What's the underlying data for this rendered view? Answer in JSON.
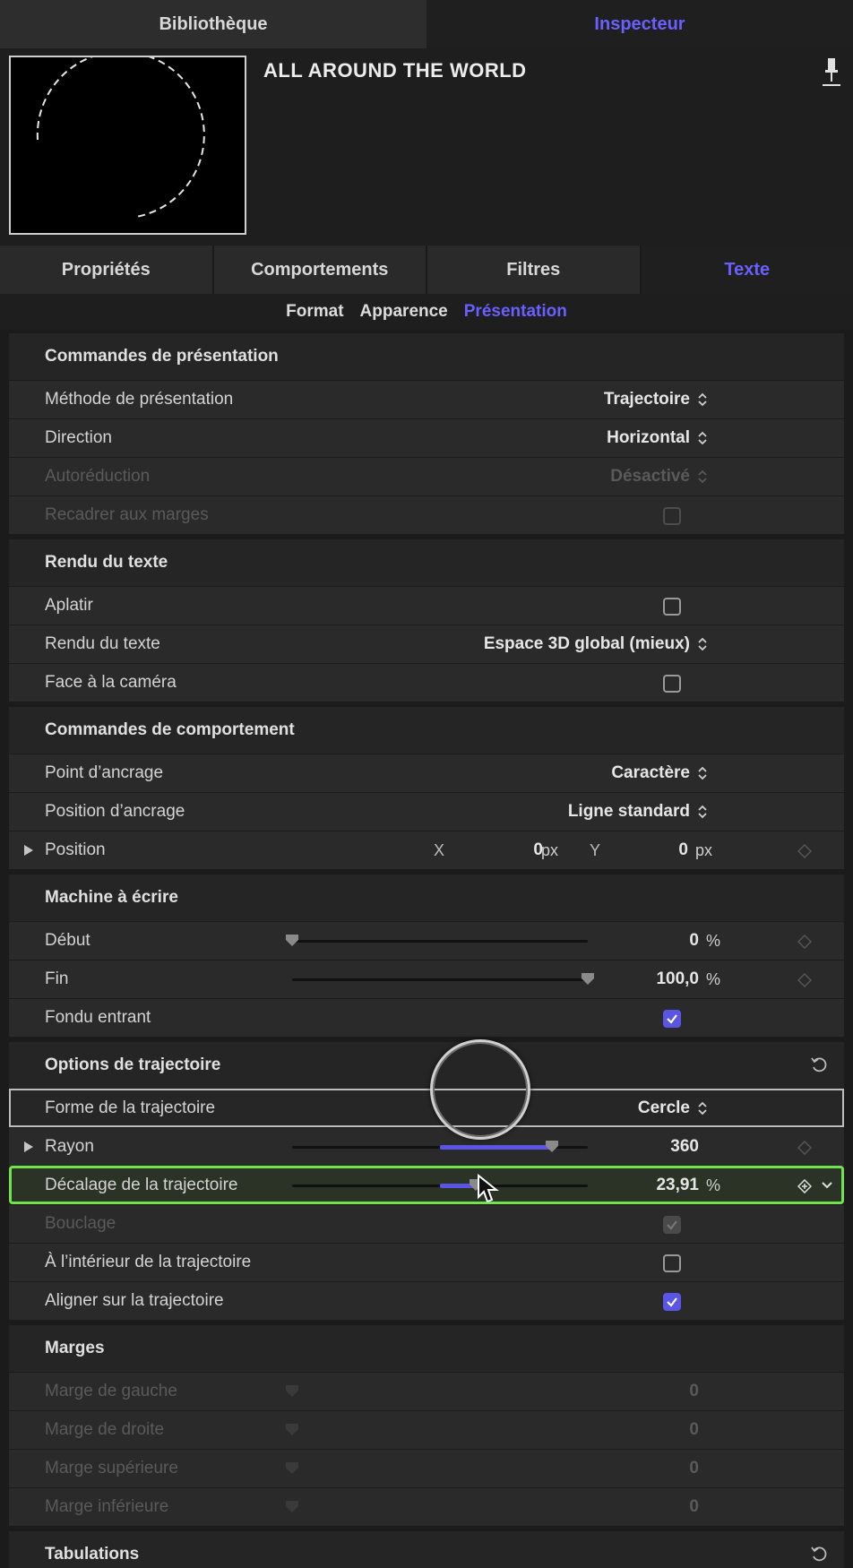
{
  "top_tabs": [
    {
      "label": "Bibliothèque",
      "active": false
    },
    {
      "label": "Inspecteur",
      "active": true
    }
  ],
  "clip": {
    "title": "ALL AROUND THE WORLD"
  },
  "sub_tabs": [
    {
      "label": "Propriétés"
    },
    {
      "label": "Comportements"
    },
    {
      "label": "Filtres"
    },
    {
      "label": "Texte",
      "active": true
    }
  ],
  "segments": [
    {
      "label": "Format"
    },
    {
      "label": "Apparence"
    },
    {
      "label": "Présentation",
      "active": true
    }
  ],
  "sections": {
    "layout": {
      "title": "Commandes de présentation",
      "method": {
        "label": "Méthode de présentation",
        "value": "Trajectoire"
      },
      "direction": {
        "label": "Direction",
        "value": "Horizontal"
      },
      "autoshrink": {
        "label": "Autoréduction",
        "value": "Désactivé"
      },
      "crop": {
        "label": "Recadrer aux marges"
      }
    },
    "render": {
      "title": "Rendu du texte",
      "flatten": {
        "label": "Aplatir"
      },
      "render_mode": {
        "label": "Rendu du texte",
        "value": "Espace 3D global (mieux)"
      },
      "face_camera": {
        "label": "Face à la caméra"
      }
    },
    "behavior": {
      "title": "Commandes de comportement",
      "anchor_point": {
        "label": "Point d’ancrage",
        "value": "Caractère"
      },
      "anchor_position": {
        "label": "Position d’ancrage",
        "value": "Ligne standard"
      },
      "position": {
        "label": "Position",
        "x_label": "X",
        "x_value": "0",
        "x_unit": "px",
        "y_label": "Y",
        "y_value": "0",
        "y_unit": "px"
      }
    },
    "typewriter": {
      "title": "Machine à écrire",
      "start": {
        "label": "Début",
        "value": "0",
        "unit": "%",
        "level": 0
      },
      "end": {
        "label": "Fin",
        "value": "100,0",
        "unit": "%",
        "level": 100
      },
      "fade_in": {
        "label": "Fondu entrant"
      }
    },
    "path": {
      "title": "Options de trajectoire",
      "shape": {
        "label": "Forme de la trajectoire",
        "value": "Cercle"
      },
      "radius": {
        "label": "Rayon",
        "value": "360",
        "level": 88
      },
      "offset": {
        "label": "Décalage de la trajectoire",
        "value": "23,91",
        "unit": "%",
        "level": 62
      },
      "loop": {
        "label": "Bouclage"
      },
      "inside": {
        "label": "À l’intérieur de la trajectoire"
      },
      "align": {
        "label": "Aligner sur la trajectoire"
      }
    },
    "margins": {
      "title": "Marges",
      "left": {
        "label": "Marge de gauche",
        "value": "0"
      },
      "right": {
        "label": "Marge de droite",
        "value": "0"
      },
      "top": {
        "label": "Marge supérieure",
        "value": "0"
      },
      "bottom": {
        "label": "Marge inférieure",
        "value": "0"
      }
    },
    "tabs": {
      "title": "Tabulations"
    }
  },
  "colors": {
    "accent": "#5b55e6",
    "highlight": "#6fe24d"
  }
}
